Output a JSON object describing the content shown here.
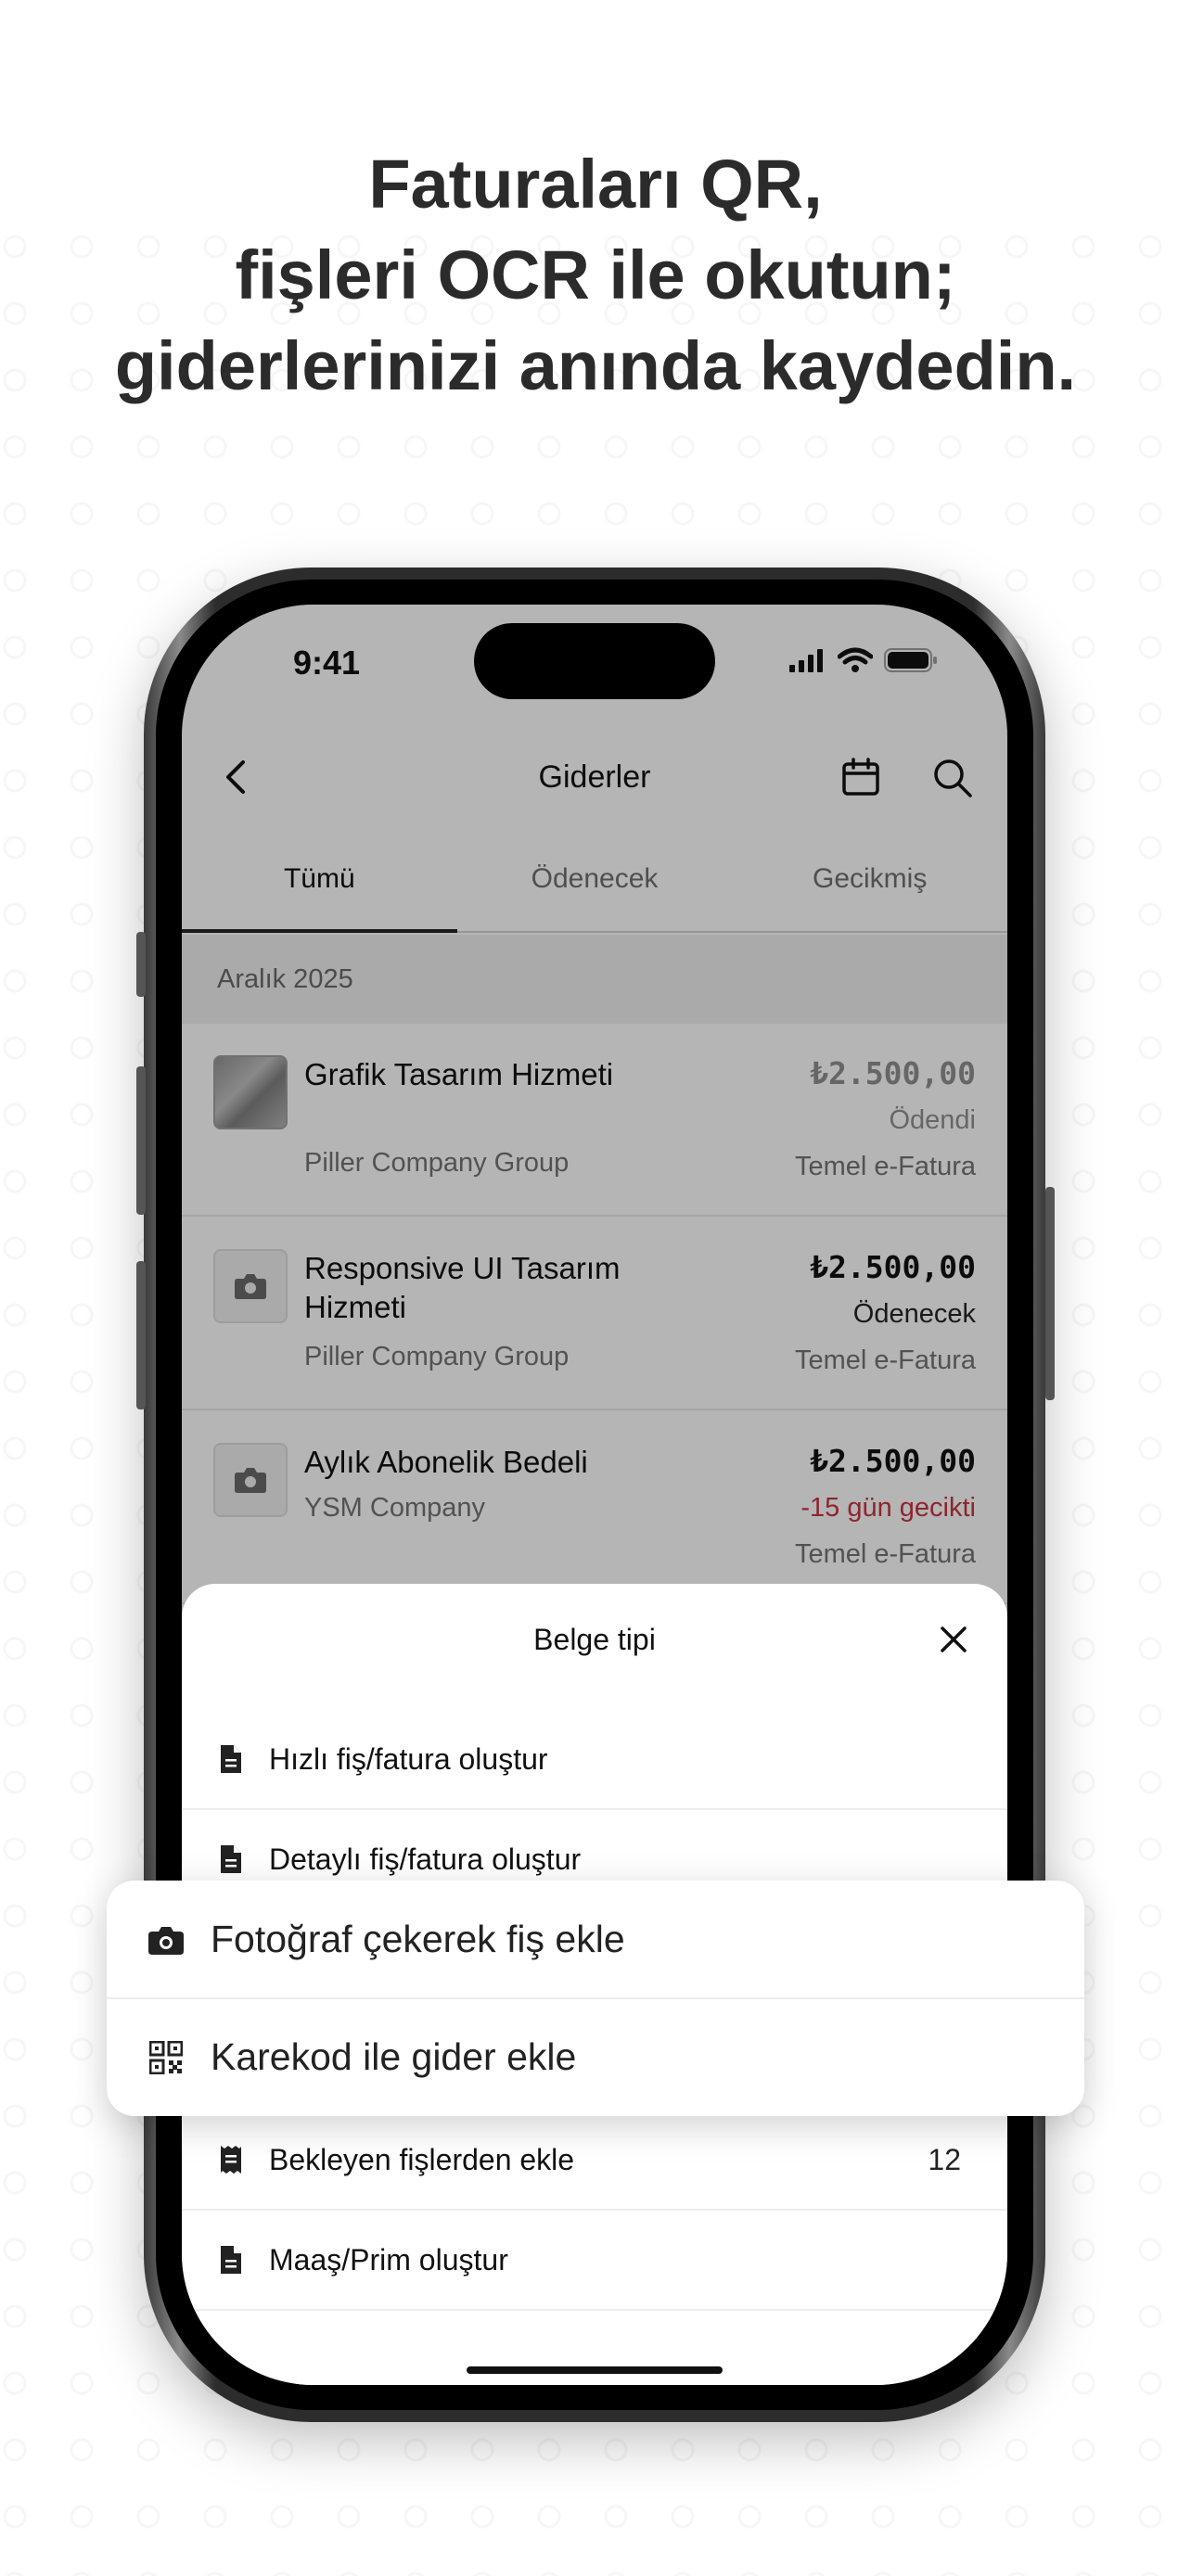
{
  "headline": [
    "Faturaları QR,",
    "fişleri OCR ile okutun;",
    "giderlerinizi anında kaydedin."
  ],
  "status_bar": {
    "time": "9:41"
  },
  "nav": {
    "title": "Giderler"
  },
  "tabs": [
    "Tümü",
    "Ödenecek",
    "Gecikmiş"
  ],
  "active_tab": "Tümü",
  "section": "Aralık 2025",
  "expenses": [
    {
      "title": "Grafik Tasarım Hizmeti",
      "company": "Piller Company Group",
      "amount": "₺2.500,00",
      "status": "Ödendi",
      "type": "Temel e-Fatura",
      "thumb": "receipt-image"
    },
    {
      "title": "Responsive UI Tasarım Hizmeti",
      "company": "Piller Company Group",
      "amount": "₺2.500,00",
      "status": "Ödenecek",
      "type": "Temel e-Fatura",
      "thumb": "camera-icon"
    },
    {
      "title": "Aylık Abonelik Bedeli",
      "company": "YSM Company",
      "amount": "₺2.500,00",
      "status": "-15 gün gecikti",
      "type": "Temel e-Fatura",
      "thumb": "camera-icon"
    }
  ],
  "colors": {
    "overdue": "#b0303a",
    "accent": "#222222"
  },
  "sheet": {
    "title": "Belge tipi",
    "items": [
      {
        "label": "Hızlı fiş/fatura oluştur",
        "icon": "document-icon"
      },
      {
        "label": "Detaylı fiş/fatura oluştur",
        "icon": "document-icon"
      },
      {
        "label": "Bekleyen fişlerden ekle",
        "icon": "receipt-icon",
        "count": "12"
      },
      {
        "label": "Maaş/Prim oluştur",
        "icon": "document-icon"
      }
    ]
  },
  "popup": {
    "items": [
      {
        "label": "Fotoğraf çekerek fiş ekle",
        "icon": "camera-icon"
      },
      {
        "label": "Karekod ile gider ekle",
        "icon": "qr-code-icon"
      }
    ]
  }
}
